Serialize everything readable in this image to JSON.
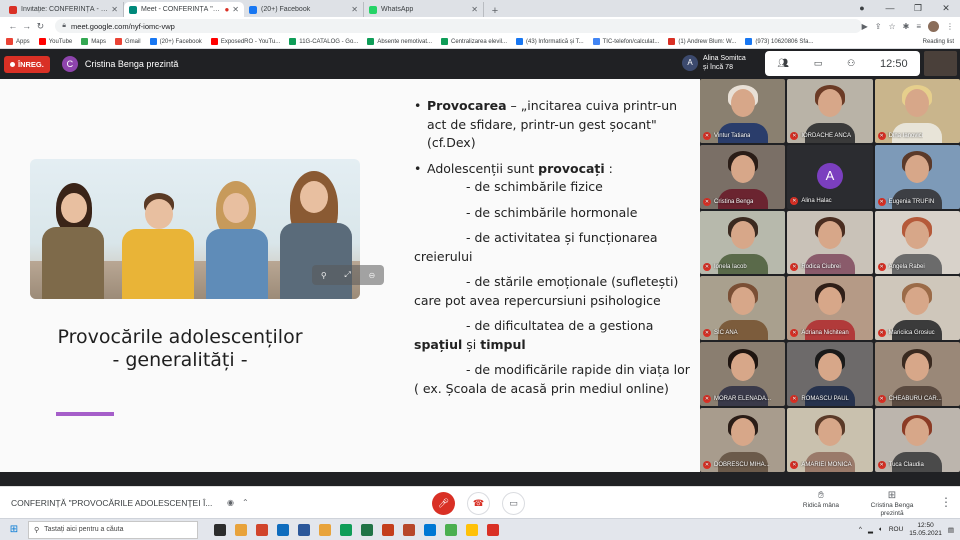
{
  "browser": {
    "tabs": [
      {
        "title": "Invitație: CONFERINȚĂ - sâm. 15 ...",
        "favicon_color": "#d93025",
        "active": false
      },
      {
        "title": "Meet - CONFERINȚĂ \"PROV...",
        "favicon_color": "#00897b",
        "active": true
      },
      {
        "title": "(20+) Facebook",
        "favicon_color": "#1877f2",
        "active": false
      },
      {
        "title": "WhatsApp",
        "favicon_color": "#25d366",
        "active": false
      }
    ],
    "new_tab_icon": "plus-icon",
    "url": "meet.google.com/nyf-iomc-vwp",
    "bookmarks": [
      {
        "label": "Apps",
        "color": "#ea4335"
      },
      {
        "label": "YouTube",
        "color": "#ff0000"
      },
      {
        "label": "Maps",
        "color": "#34a853"
      },
      {
        "label": "Gmail",
        "color": "#ea4335"
      },
      {
        "label": "(20+) Facebook",
        "color": "#1877f2"
      },
      {
        "label": "ExposedRO - YouTu...",
        "color": "#ff0000"
      },
      {
        "label": "11G-CATALOG - Go...",
        "color": "#0f9d58"
      },
      {
        "label": "Absente nemotivat...",
        "color": "#0f9d58"
      },
      {
        "label": "Centralizarea elevil...",
        "color": "#0f9d58"
      },
      {
        "label": "(43) Informatică și T...",
        "color": "#1877f2"
      },
      {
        "label": "TIC-telefon/calculat...",
        "color": "#4285f4"
      },
      {
        "label": "(1) Andrew Blum: W...",
        "color": "#d93025"
      },
      {
        "label": "(973) 10620806 Sfa...",
        "color": "#1877f2"
      }
    ],
    "reading_list": "Reading list"
  },
  "meet": {
    "recording_label": "ÎNREG.",
    "presenter_initial": "C",
    "presenting_text": "Cristina Benga prezintă",
    "participant_initial": "A",
    "participant_text_1": "Alina Somitca",
    "participant_text_2": "și încă 78",
    "clock": "12:50",
    "meeting_title": "CONFERINȚĂ \"PROVOCĂRILE ADOLESCENȚEI Î...",
    "raise_hand": "Ridică mâna",
    "presenter_btn_1": "Cristina Benga",
    "presenter_btn_2": "prezintă"
  },
  "slide": {
    "title_line1": "Provocările adolescenților",
    "title_line2": "- generalități -",
    "bullet1_bold": "Provocarea",
    "bullet1_rest": " – „incitarea cuiva printr-un act de sfidare, printr-un gest șocant\" (cf.Dex)",
    "bullet2_pre": "Adolescenții sunt ",
    "bullet2_bold": "provocați",
    "bullet2_post": " :",
    "items": [
      "- de schimbările fizice",
      "- de schimbările hormonale",
      "- de activitatea și funcționarea creierului",
      "- de stările emoționale (sufletești) care pot avea repercursiuni psihologice"
    ],
    "item5_pre": "- de dificultatea de a gestiona ",
    "item5_b1": "spațiul",
    "item5_mid": " și ",
    "item5_b2": "timpul",
    "item6": "- de modificările rapide din viața lor ( ex. Școala de acasă prin mediul online)",
    "accent_color": "#a55ec9"
  },
  "participants": [
    {
      "name": "Vintur Tatiana",
      "bg": "#8a8070",
      "hair": "#e8e0d6",
      "shirt": "#2a3d6b"
    },
    {
      "name": "IORDACHE ANCA",
      "bg": "#b9b3a7",
      "hair": "#6b3b26",
      "shirt": "#3a3a3a"
    },
    {
      "name": "Dina Ianovici",
      "bg": "#c9b58c",
      "hair": "#e6cf8c",
      "shirt": "#e8e4d8"
    },
    {
      "name": "Cristina Benga",
      "bg": "#7a6f66",
      "hair": "#2a1d17",
      "shirt": "#6b2430"
    },
    {
      "name": "Alina Halac",
      "bg": "#2b2c30",
      "letter": "A"
    },
    {
      "name": "Eugenia TRUFIN",
      "bg": "#7d9ab8",
      "hair": "#5b3a2a",
      "shirt": "#3d3f44"
    },
    {
      "name": "Ionela Iacob",
      "bg": "#b7b9ac",
      "hair": "#3b2a20",
      "shirt": "#5a6a4a"
    },
    {
      "name": "Rodica Ciubrei",
      "bg": "#c9c2b8",
      "hair": "#4a2d20",
      "shirt": "#8a5b6b"
    },
    {
      "name": "Angela Rabei",
      "bg": "#d8d2ca",
      "hair": "#b55a3a",
      "shirt": "#6b6b6b"
    },
    {
      "name": "SIC ANA",
      "bg": "#a9a08e",
      "hair": "#7a4f35",
      "shirt": "#7c5c3c"
    },
    {
      "name": "Adriana Nichitean",
      "bg": "#b59a86",
      "hair": "#2f1f18",
      "shirt": "#b13a3a"
    },
    {
      "name": "Mariciica Grosiuc",
      "bg": "#cfc7bb",
      "hair": "#9b6b48",
      "shirt": "#3b3b3b"
    },
    {
      "name": "MORAR ELENADA...",
      "bg": "#8a7e70",
      "hair": "#1f1510",
      "shirt": "#3a3a4a"
    },
    {
      "name": "ROMASCU PAUL",
      "bg": "#6d6a6a",
      "hair": "#1a1a1a",
      "shirt": "#26324d"
    },
    {
      "name": "CHEABURU CAR...",
      "bg": "#9a8878",
      "hair": "#3a2a20",
      "shirt": "#5a4a40"
    },
    {
      "name": "DOBRESCU MIHA...",
      "bg": "#a89c8d",
      "hair": "#2a1d17",
      "shirt": "#6b5a4a"
    },
    {
      "name": "AMARIEI MONICA",
      "bg": "#c9c1ae",
      "hair": "#5a3a28",
      "shirt": "#9a7a6a"
    },
    {
      "name": "Tuca Claudia",
      "bg": "#bcb5ad",
      "hair": "#8b3b25",
      "shirt": "#4a4a4a"
    }
  ],
  "taskbar": {
    "search_placeholder": "Tastați aici pentru a căuta",
    "apps": [
      "#2d2d2d",
      "#e8a33b",
      "#d1442b",
      "#0f6cbd",
      "#2b579a",
      "#e8a33b",
      "#0f9d58",
      "#217346",
      "#c43e1c",
      "#b7472a",
      "#0078d4",
      "#4caf50",
      "#ffc107",
      "#d93025"
    ],
    "lang": "ROU",
    "time": "12:50",
    "date": "15.05.2021"
  }
}
